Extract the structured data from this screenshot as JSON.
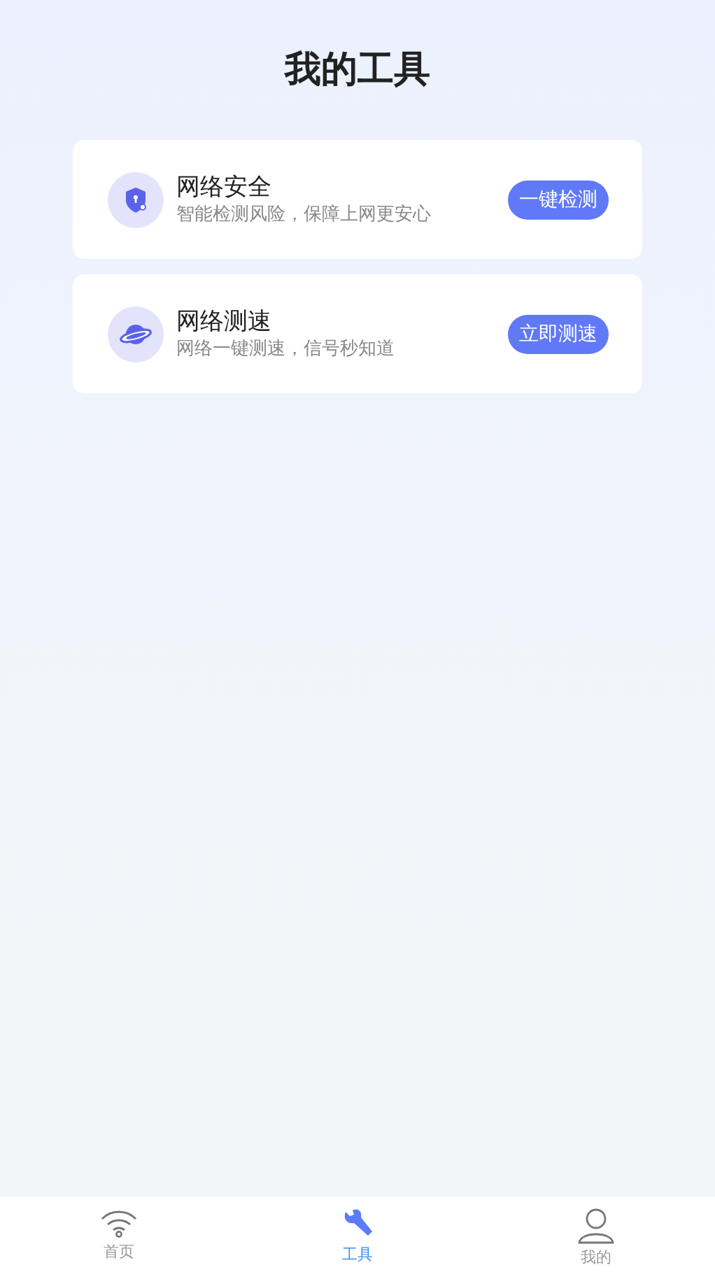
{
  "page": {
    "title": "我的工具"
  },
  "tools": [
    {
      "kind": "shield",
      "name": "网络安全",
      "description": "智能检测风险，保障上网更安心",
      "action": "一键检测"
    },
    {
      "kind": "planet",
      "name": "网络测速",
      "description": "网络一键测速，信号秒知道",
      "action": "立即测速"
    }
  ],
  "tab_bar": [
    {
      "kind": "wifi",
      "label": "首页",
      "selected": false
    },
    {
      "kind": "wrench",
      "label": "工具",
      "selected": true
    },
    {
      "kind": "person",
      "label": "我的",
      "selected": false
    }
  ]
}
